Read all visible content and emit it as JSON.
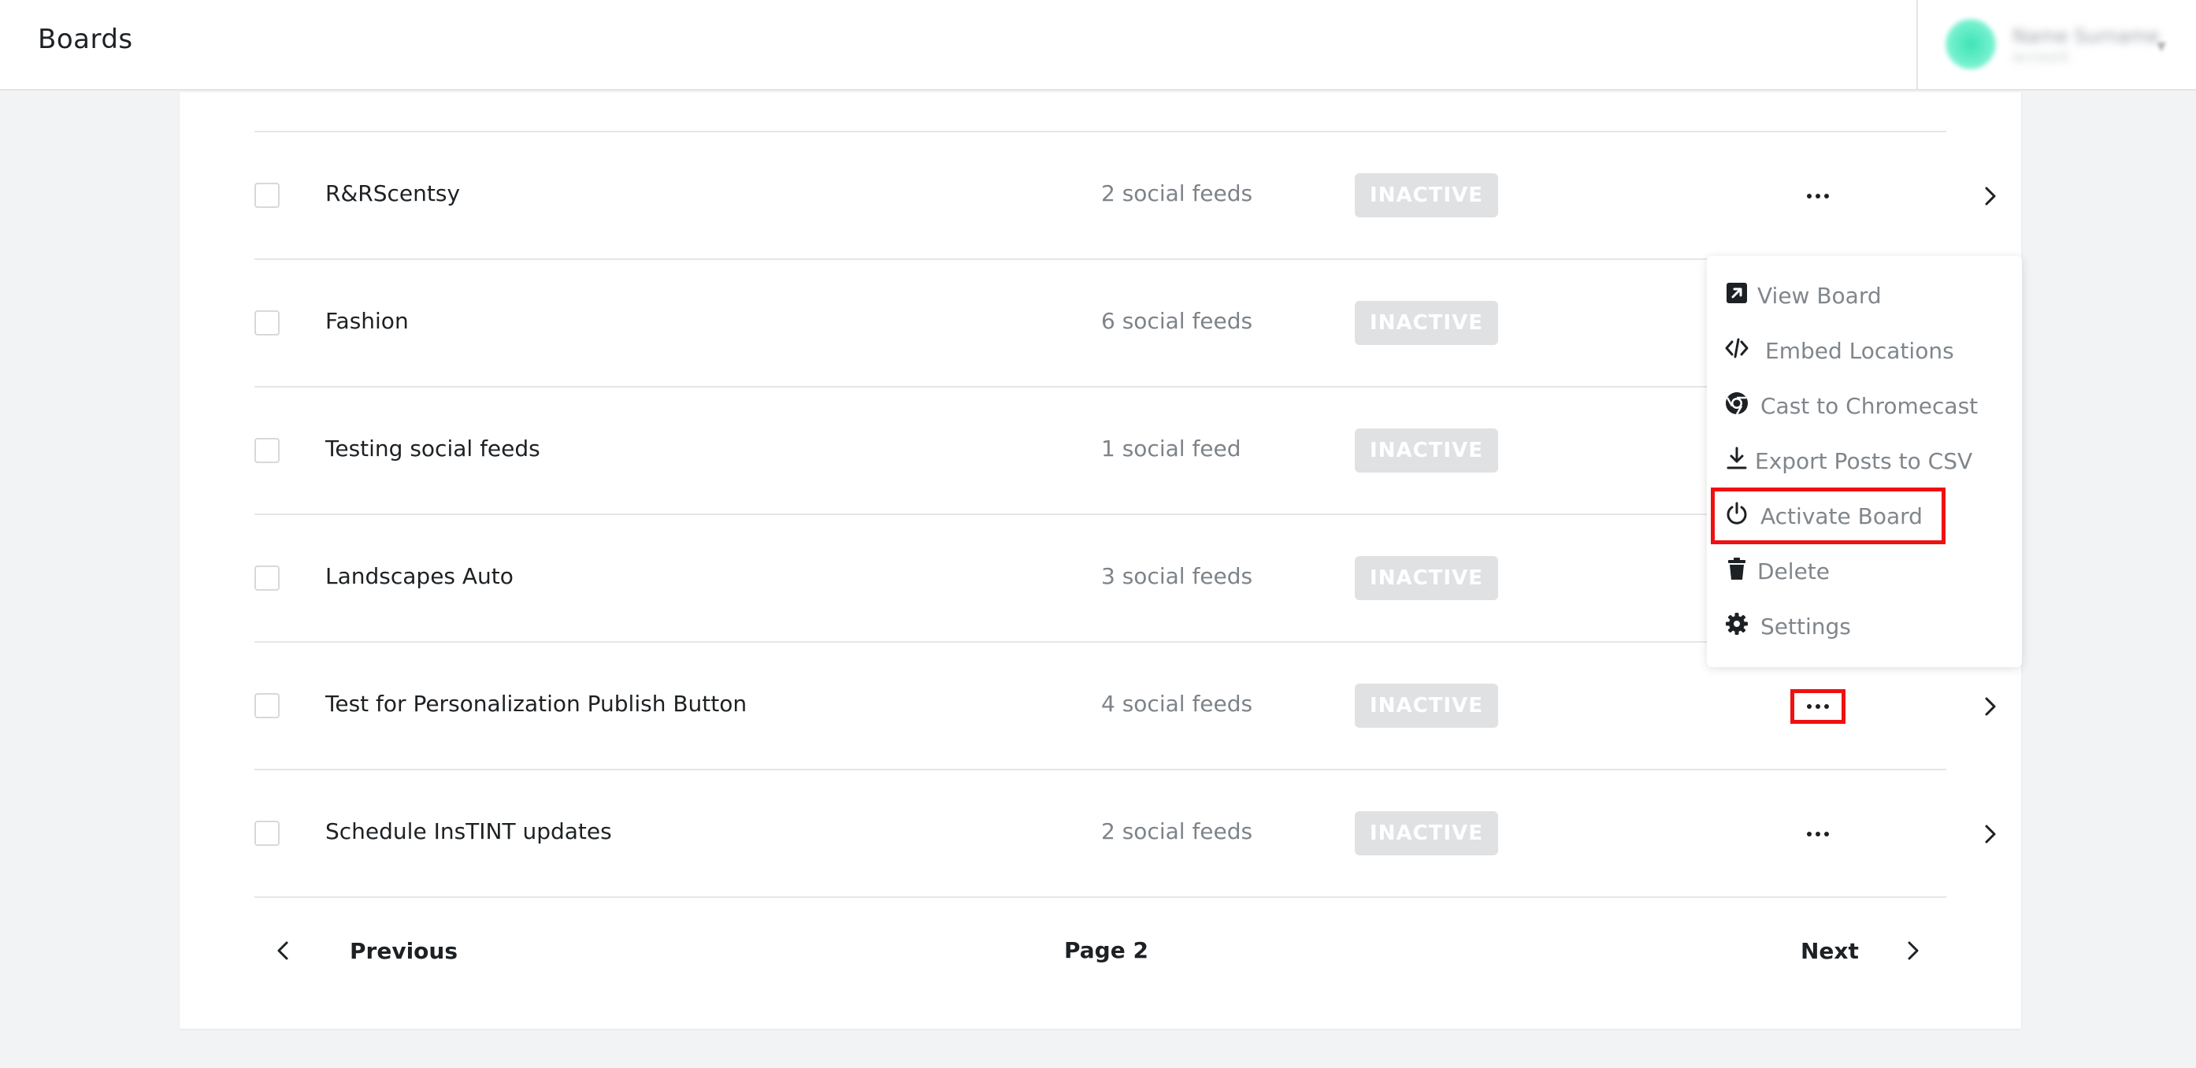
{
  "header": {
    "title": "Boards",
    "user_name": "Name Surname",
    "user_subtitle": "account",
    "caret": "▾",
    "avatar_color": "#3ee3b7"
  },
  "boards": [
    {
      "name": "R&RScentsy",
      "feeds": "2 social feeds",
      "status": "INACTIVE"
    },
    {
      "name": "Fashion",
      "feeds": "6 social feeds",
      "status": "INACTIVE"
    },
    {
      "name": "Testing social feeds",
      "feeds": "1 social feed",
      "status": "INACTIVE"
    },
    {
      "name": "Landscapes Auto",
      "feeds": "3 social feeds",
      "status": "INACTIVE"
    },
    {
      "name": "Test for Personalization Publish Button",
      "feeds": "4 social feeds",
      "status": "INACTIVE"
    },
    {
      "name": "Schedule InsTINT updates",
      "feeds": "2 social feeds",
      "status": "INACTIVE"
    }
  ],
  "menu": {
    "items": [
      {
        "label": "View Board",
        "icon": "external-link-icon"
      },
      {
        "label": "Embed Locations",
        "icon": "code-icon"
      },
      {
        "label": "Cast to Chromecast",
        "icon": "chrome-icon"
      },
      {
        "label": "Export Posts to CSV",
        "icon": "download-icon"
      },
      {
        "label": "Activate Board",
        "icon": "power-icon"
      },
      {
        "label": "Delete",
        "icon": "trash-icon"
      },
      {
        "label": "Settings",
        "icon": "gear-icon"
      }
    ]
  },
  "pagination": {
    "previous": "Previous",
    "page": "Page 2",
    "next": "Next"
  },
  "colors": {
    "highlight": "#ee1111",
    "badge_bg": "#e0e1e2",
    "background": "#f2f3f4"
  }
}
